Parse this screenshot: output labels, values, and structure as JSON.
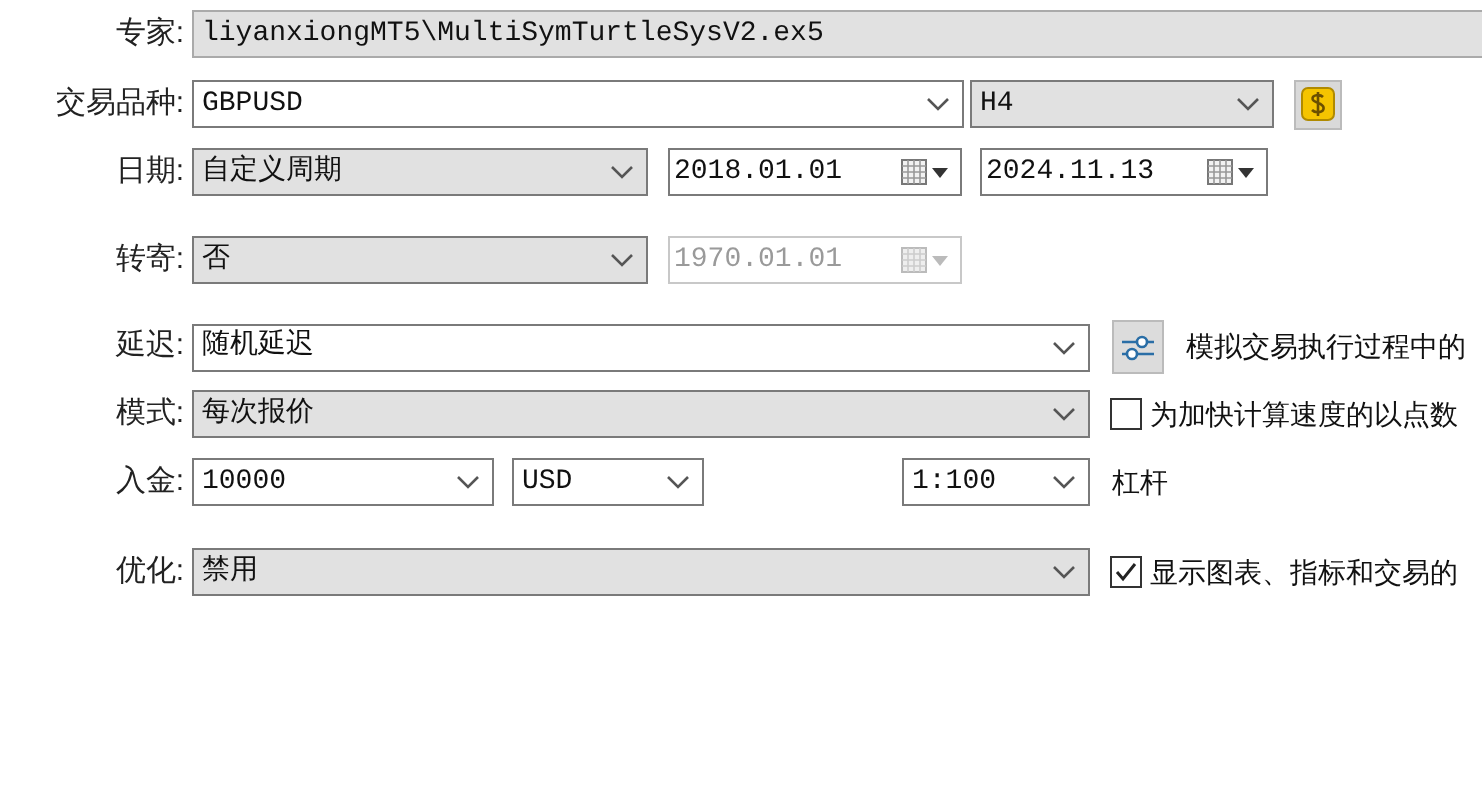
{
  "expert": {
    "label": "专家:",
    "value": "liyanxiongMT5\\MultiSymTurtleSysV2.ex5"
  },
  "symbol": {
    "label": "交易品种:",
    "value": "GBPUSD",
    "timeframe": "H4"
  },
  "date": {
    "label": "日期:",
    "mode": "自定义周期",
    "from": "2018.01.01",
    "to": "2024.11.13"
  },
  "forward": {
    "label": "转寄:",
    "mode": "否",
    "date": "1970.01.01",
    "date_disabled": true
  },
  "delay": {
    "label": "延迟:",
    "value": "随机延迟",
    "note": "模拟交易执行过程中的"
  },
  "modeling": {
    "label": "模式:",
    "value": "每次报价",
    "option": {
      "label": "为加快计算速度的以点数",
      "checked": false
    }
  },
  "deposit": {
    "label": "入金:",
    "value": "10000",
    "currency": "USD",
    "leverage": "1:100",
    "leverage_label": "杠杆"
  },
  "optimization": {
    "label": "优化:",
    "value": "禁用",
    "option": {
      "label": "显示图表、指标和交易的",
      "checked": true
    }
  }
}
